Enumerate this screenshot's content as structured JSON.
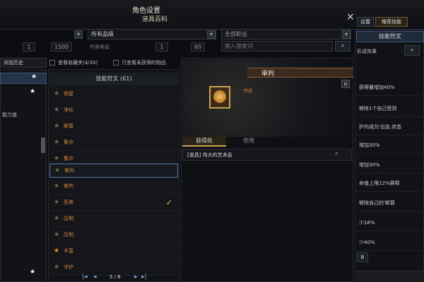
{
  "window": {
    "title": "角色设置",
    "subtitle": "道具百科",
    "close": "×"
  },
  "filters": {
    "grade": "所有品级",
    "job": "全部职业",
    "search_placeholder": "输入搜索词",
    "level_min_left": "1",
    "level_max_left": "1500",
    "level_label": "所需等级",
    "level_min": "1",
    "level_max": "60"
  },
  "sidebar": {
    "header": "浏览历史",
    "items": [
      "能力值"
    ]
  },
  "checkboxes": {
    "favorites": "查看收藏夹(4/30)",
    "unobtained": "只查看未获得的物品"
  },
  "list": {
    "header": "技能符文 (61)",
    "items": [
      "铁壁",
      "净化",
      "断罪",
      "集中",
      "集中",
      "审判",
      "审判",
      "狂奔",
      "压制",
      "压制",
      "丰富",
      "守护"
    ],
    "pagination": "5 / 6"
  },
  "detail": {
    "name": "审判",
    "grade": "传说",
    "tab_obtain": "获得处",
    "tab_use": "使用",
    "source": "[道具] 伟大的艺术品"
  },
  "right_panel": {
    "tab_reset": "设置",
    "tab_recommend": "推荐技能",
    "header": "技能符文",
    "subheader": "彩成效果",
    "lines": [
      "获得量增加40%",
      "够除1个自己受到",
      "护内成为'出血,状态",
      "增加30%",
      "增加30%",
      "命值上限12%屏障",
      "够除自己的'断罪",
      "少16%",
      "少40%"
    ],
    "button": "B"
  },
  "colors": {
    "accent": "#d8873a",
    "gold": "#c7a455",
    "selected_border": "#5a7aa5"
  }
}
